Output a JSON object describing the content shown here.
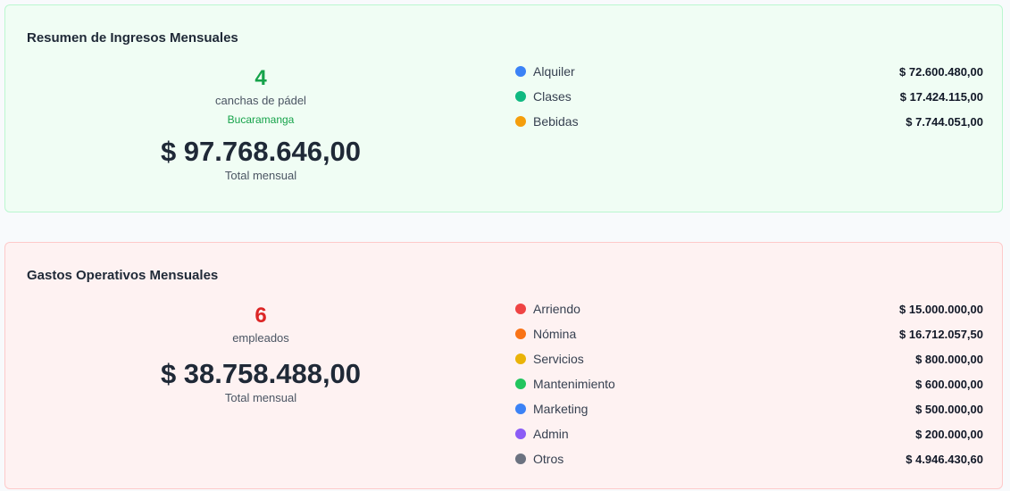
{
  "income": {
    "title": "Resumen de Ingresos Mensuales",
    "count": "4",
    "count_label": "canchas de pádel",
    "city": "Bucaramanga",
    "total": "$ 97.768.646,00",
    "total_label": "Total mensual",
    "items": [
      {
        "label": "Alquiler",
        "value": "$ 72.600.480,00",
        "color": "#3b82f6"
      },
      {
        "label": "Clases",
        "value": "$ 17.424.115,00",
        "color": "#10b981"
      },
      {
        "label": "Bebidas",
        "value": "$ 7.744.051,00",
        "color": "#f59e0b"
      }
    ]
  },
  "expenses": {
    "title": "Gastos Operativos Mensuales",
    "count": "6",
    "count_label": "empleados",
    "total": "$ 38.758.488,00",
    "total_label": "Total mensual",
    "items": [
      {
        "label": "Arriendo",
        "value": "$ 15.000.000,00",
        "color": "#ef4444"
      },
      {
        "label": "Nómina",
        "value": "$ 16.712.057,50",
        "color": "#f97316"
      },
      {
        "label": "Servicios",
        "value": "$ 800.000,00",
        "color": "#eab308"
      },
      {
        "label": "Mantenimiento",
        "value": "$ 600.000,00",
        "color": "#22c55e"
      },
      {
        "label": "Marketing",
        "value": "$ 500.000,00",
        "color": "#3b82f6"
      },
      {
        "label": "Admin",
        "value": "$ 200.000,00",
        "color": "#8b5cf6"
      },
      {
        "label": "Otros",
        "value": "$ 4.946.430,60",
        "color": "#6b7280"
      }
    ]
  }
}
